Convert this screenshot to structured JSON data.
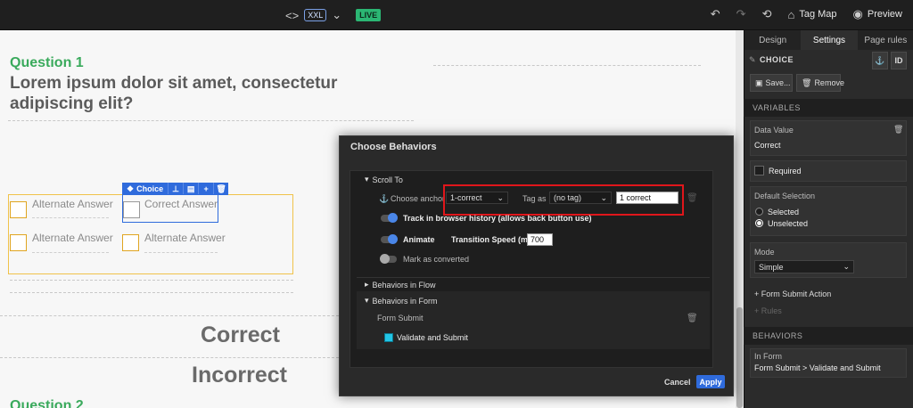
{
  "topbar": {
    "view_code_icon": "<>",
    "breakpoint": "XXL",
    "live": "LIVE",
    "tag_map": "Tag Map",
    "preview": "Preview"
  },
  "canvas": {
    "question_label": "Question 1",
    "question_text": "Lorem ipsum dolor sit amet, consectetur adipiscing elit?",
    "choice_tag": "Choice",
    "answers": [
      "Alternate Answer",
      "Correct Answer",
      "Alternate Answer",
      "Alternate Answer"
    ],
    "correct_word": "Correct",
    "incorrect_word": "Incorrect",
    "question2_label": "Question 2"
  },
  "modal": {
    "title": "Choose Behaviors",
    "scroll_to": "Scroll To",
    "choose_anchor_label": "Choose anchor",
    "anchor_value": "1-correct",
    "tag_as_label": "Tag as",
    "tag_value": "(no tag)",
    "tag_input": "1 correct",
    "track_history": "Track in browser history (allows back button use)",
    "animate": "Animate",
    "transition_label": "Transition Speed (ms)",
    "transition_value": "700",
    "mark_converted": "Mark as converted",
    "behaviors_in_flow": "Behaviors in Flow",
    "behaviors_in_form": "Behaviors in Form",
    "form_submit": "Form Submit",
    "validate_submit": "Validate and Submit",
    "cancel": "Cancel",
    "apply": "Apply"
  },
  "panel": {
    "tabs": [
      "Design",
      "Settings",
      "Page rules"
    ],
    "active_tab": "Settings",
    "element_name": "CHOICE",
    "id_button": "ID",
    "save_button": "Save...",
    "remove_button": "Remove",
    "variables_header": "VARIABLES",
    "data_value_label": "Data Value",
    "data_value": "Correct",
    "required": "Required",
    "default_selection_label": "Default Selection",
    "selected": "Selected",
    "unselected": "Unselected",
    "mode_label": "Mode",
    "mode_value": "Simple",
    "form_submit_action": "+ Form Submit Action",
    "rules": "+ Rules",
    "behaviors_header": "BEHAVIORS",
    "in_form_label": "In Form",
    "in_form_value": "Form Submit > Validate and Submit"
  },
  "colors": {
    "accent_blue": "#2f6bdc",
    "question_green": "#3aaa5c",
    "highlight_red": "#e0161b"
  }
}
